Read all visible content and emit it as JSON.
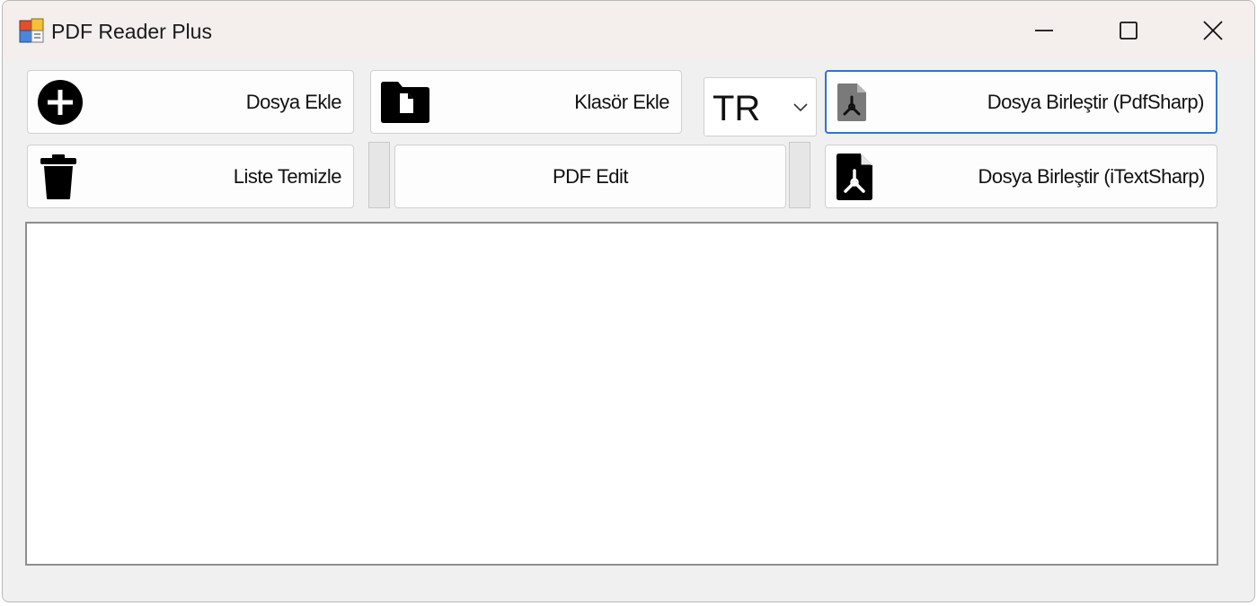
{
  "window": {
    "title": "PDF Reader Plus"
  },
  "toolbar": {
    "add_file_label": "Dosya Ekle",
    "add_folder_label": "Klasör Ekle",
    "language_selected": "TR",
    "merge_pdfsharp_label": "Dosya Birleştir (PdfSharp)",
    "clear_list_label": "Liste Temizle",
    "pdf_edit_label": "PDF Edit",
    "merge_itextsharp_label": "Dosya Birleştir (iTextSharp)"
  },
  "icons": {
    "add_file": "plus-circle-icon",
    "add_folder": "folder-icon",
    "merge_pdfsharp": "pdf-file-icon",
    "clear_list": "trash-icon",
    "merge_itextsharp": "pdf-file-icon"
  },
  "colors": {
    "focus_border": "#2f74d0",
    "window_bg": "#f0f0f0",
    "titlebar_bg": "#f4efed"
  }
}
